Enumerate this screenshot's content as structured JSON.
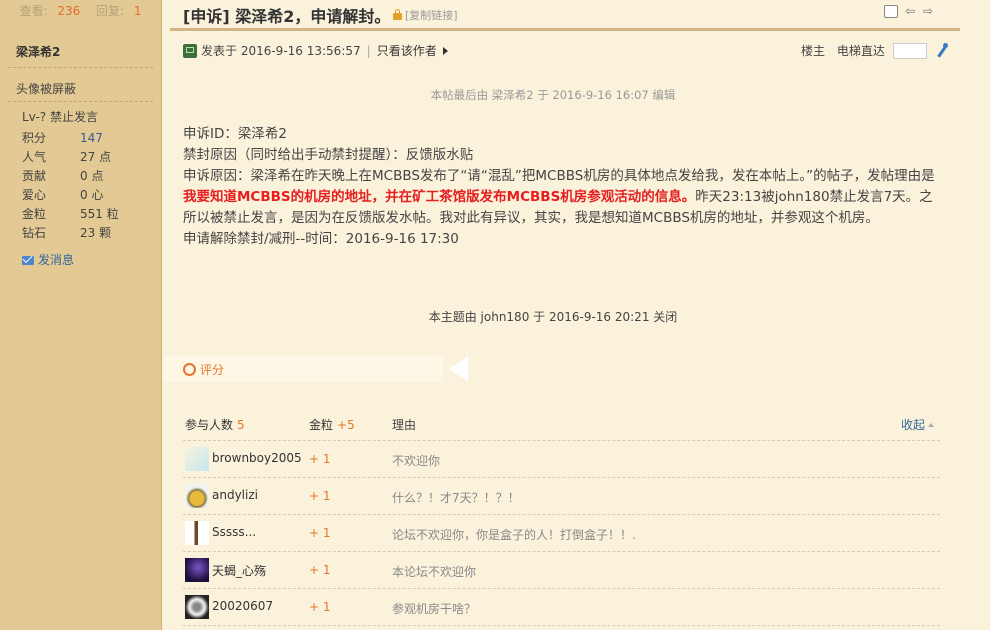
{
  "sidebar": {
    "views_label": "查看:",
    "views_value": "236",
    "replies_label": "回复:",
    "replies_value": "1",
    "username": "梁泽希2",
    "avatar_status": "头像被屏蔽",
    "level": "Lv-? 禁止发言",
    "stats": [
      {
        "label": "积分",
        "value": "147"
      },
      {
        "label": "人气",
        "value": "27 点"
      },
      {
        "label": "贡献",
        "value": "0 点"
      },
      {
        "label": "爱心",
        "value": "0 心"
      },
      {
        "label": "金粒",
        "value": "551 粒"
      },
      {
        "label": "钻石",
        "value": "23 颗"
      }
    ],
    "send_message": "发消息"
  },
  "thread": {
    "title": "[申诉] 梁泽希2，申请解封。",
    "copy_link": "[复制链接]"
  },
  "post": {
    "posted_at": "发表于 2016-9-16 13:56:57",
    "author_only": "只看该作者",
    "floor": "楼主",
    "elevator": "电梯直达",
    "edited_note": "本帖最后由 梁泽希2 于 2016-9-16 16:07 编辑",
    "line1": "申诉ID：梁泽希2",
    "line2": "禁封原因（同时给出手动禁封提醒）：反馈版水贴",
    "line3_a": "申诉原因：梁泽希在昨天晚上在MCBBS发布了“请“混乱”把MCBBS机房的具体地点发给我，发在本帖上。”的帖子，发帖理由是",
    "line3_hl": "我要知道MCBBS的机房的地址，并在矿工茶馆版发布MCBBS机房参观活动的信息。",
    "line3_b": "昨天23:13被john180禁止发言7天。之所以被禁止发言，是因为在反馈版发水帖。我对此有异议，其实，我是想知道MCBBS机房的地址，并参观这个机房。",
    "line4": "申请解除禁封/减刑--时间：2016-9-16 17:30",
    "closed_note": "本主题由 john180 于 2016-9-16 20:21 关闭"
  },
  "rating": {
    "tab_label": "评分",
    "col_participants": "参与人数",
    "participants_count": "5",
    "col_gold": "金粒",
    "gold_total": "+5",
    "col_reason": "理由",
    "collapse": "收起",
    "rows": [
      {
        "name": "brownboy2005",
        "score": "+ 1",
        "reason": "不欢迎你"
      },
      {
        "name": "andylizi",
        "score": "+ 1",
        "reason": "什么？！才7天？！？！"
      },
      {
        "name": "Sssss...",
        "score": "+ 1",
        "reason": "论坛不欢迎你，你是盒子的人！打倒盒子！！."
      },
      {
        "name": "天蝎_心殇",
        "score": "+ 1",
        "reason": "本论坛不欢迎你"
      },
      {
        "name": "20020607",
        "score": "+ 1",
        "reason": "参观机房干啥？"
      }
    ]
  }
}
